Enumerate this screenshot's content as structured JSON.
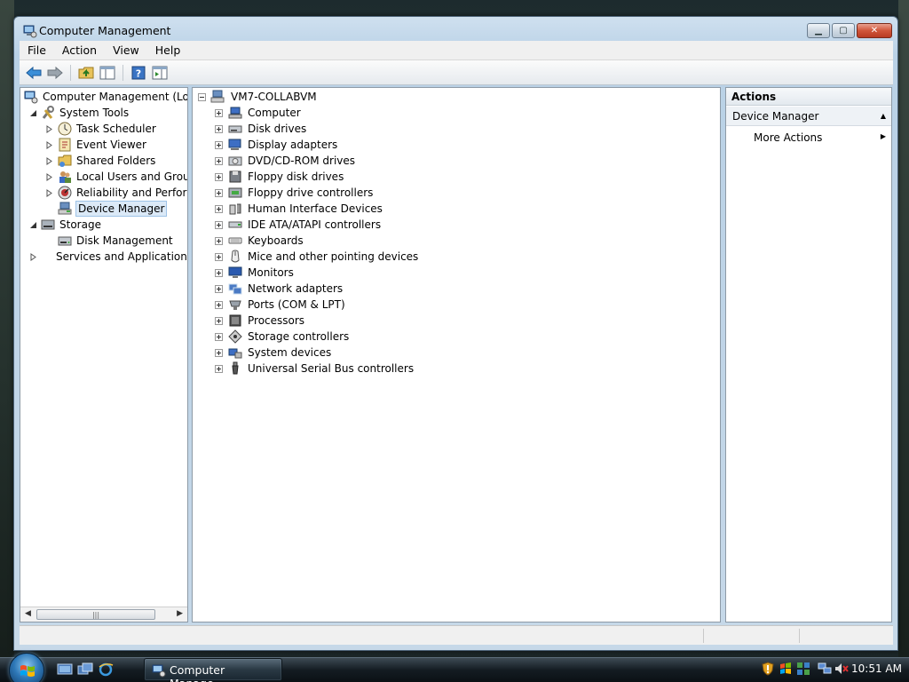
{
  "window": {
    "title": "Computer Management",
    "buttons": {
      "minimize": "▁",
      "maximize": "▢",
      "close": "✕"
    }
  },
  "menu": [
    "File",
    "Action",
    "View",
    "Help"
  ],
  "toolbar": {
    "icons": [
      "back-arrow-icon",
      "forward-arrow-icon",
      "up-folder-icon",
      "show-hide-tree-icon",
      "help-icon",
      "show-hide-action-pane-icon"
    ]
  },
  "left_tree": {
    "root": "Computer Management (Local",
    "system_tools": "System Tools",
    "task_scheduler": "Task Scheduler",
    "event_viewer": "Event Viewer",
    "shared_folders": "Shared Folders",
    "local_users": "Local Users and Groups",
    "reliability": "Reliability and Performa",
    "device_manager": "Device Manager",
    "storage": "Storage",
    "disk_management": "Disk Management",
    "services": "Services and Applications"
  },
  "device_tree": {
    "root": "VM7-COLLABVM",
    "categories": [
      "Computer",
      "Disk drives",
      "Display adapters",
      "DVD/CD-ROM drives",
      "Floppy disk drives",
      "Floppy drive controllers",
      "Human Interface Devices",
      "IDE ATA/ATAPI controllers",
      "Keyboards",
      "Mice and other pointing devices",
      "Monitors",
      "Network adapters",
      "Ports (COM & LPT)",
      "Processors",
      "Storage controllers",
      "System devices",
      "Universal Serial Bus controllers"
    ]
  },
  "actions": {
    "header": "Actions",
    "section": "Device Manager",
    "more": "More Actions"
  },
  "taskbar": {
    "task_label": "Computer Manage...",
    "clock": "10:51 AM"
  },
  "colors": {
    "selection_bg": "#dbe9f7",
    "selection_border": "#9fc3e7",
    "title_accent": "#b9d1e6"
  }
}
